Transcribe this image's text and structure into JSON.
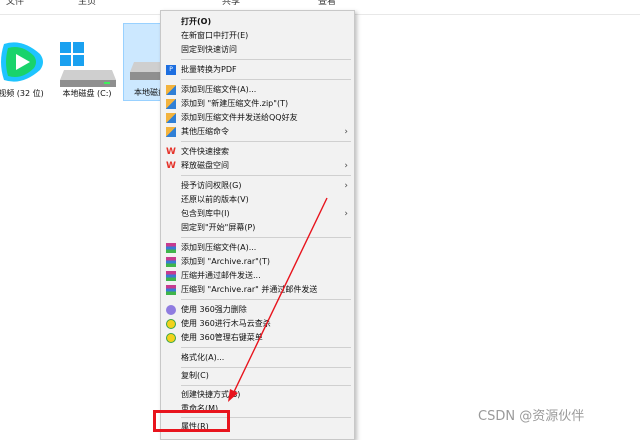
{
  "top_tabs": [
    "文件",
    "主页",
    "共享",
    "查看"
  ],
  "files": [
    {
      "label": "视频 (32 位)",
      "icon": "tencent-video-icon"
    },
    {
      "label": "本地磁盘 (C:)",
      "icon": "windows-drive-icon"
    },
    {
      "label": "本地磁盘",
      "icon": "hard-drive-icon"
    }
  ],
  "menu": {
    "items": [
      {
        "label": "打开(O)",
        "icon": "",
        "arrow": false,
        "bold": true
      },
      {
        "label": "在新窗口中打开(E)",
        "icon": "",
        "arrow": false
      },
      {
        "label": "固定到快速访问",
        "icon": "",
        "arrow": false
      },
      {
        "label": "批量转换为PDF",
        "icon": "pdf-icon",
        "arrow": false
      },
      {
        "label": "添加到压缩文件(A)...",
        "icon": "archive-icon",
        "arrow": false
      },
      {
        "label": "添加到 \"新建压缩文件.zip\"(T)",
        "icon": "archive-icon",
        "arrow": false
      },
      {
        "label": "添加到压缩文件并发送给QQ好友",
        "icon": "archive-icon",
        "arrow": false
      },
      {
        "label": "其他压缩命令",
        "icon": "archive-icon",
        "arrow": true
      },
      {
        "label": "文件快速搜索",
        "icon": "wps-icon",
        "arrow": false
      },
      {
        "label": "释放磁盘空间",
        "icon": "wps-icon",
        "arrow": true
      },
      {
        "label": "授予访问权限(G)",
        "icon": "",
        "arrow": true
      },
      {
        "label": "还原以前的版本(V)",
        "icon": "",
        "arrow": false
      },
      {
        "label": "包含到库中(I)",
        "icon": "",
        "arrow": true
      },
      {
        "label": "固定到\"开始\"屏幕(P)",
        "icon": "",
        "arrow": false
      },
      {
        "label": "添加到压缩文件(A)...",
        "icon": "winrar-icon",
        "arrow": false
      },
      {
        "label": "添加到 \"Archive.rar\"(T)",
        "icon": "winrar-icon",
        "arrow": false
      },
      {
        "label": "压缩并通过邮件发送...",
        "icon": "winrar-icon",
        "arrow": false
      },
      {
        "label": "压缩到 \"Archive.rar\" 并通过邮件发送",
        "icon": "winrar-icon",
        "arrow": false
      },
      {
        "label": "使用 360强力删除",
        "icon": "360-delete-icon",
        "arrow": false
      },
      {
        "label": "使用 360进行木马云查杀",
        "icon": "360-scan-icon",
        "arrow": false
      },
      {
        "label": "使用 360管理右键菜单",
        "icon": "360-scan-icon",
        "arrow": false
      },
      {
        "label": "格式化(A)...",
        "icon": "",
        "arrow": false
      },
      {
        "label": "复制(C)",
        "icon": "",
        "arrow": false
      },
      {
        "label": "创建快捷方式(S)",
        "icon": "",
        "arrow": false
      },
      {
        "label": "重命名(M)",
        "icon": "",
        "arrow": false
      },
      {
        "label": "属性(R)",
        "icon": "",
        "arrow": false
      }
    ]
  },
  "watermark": "CSDN @资源伙伴",
  "colors": {
    "highlight": "#e8141d",
    "selection": "#cce8ff"
  }
}
